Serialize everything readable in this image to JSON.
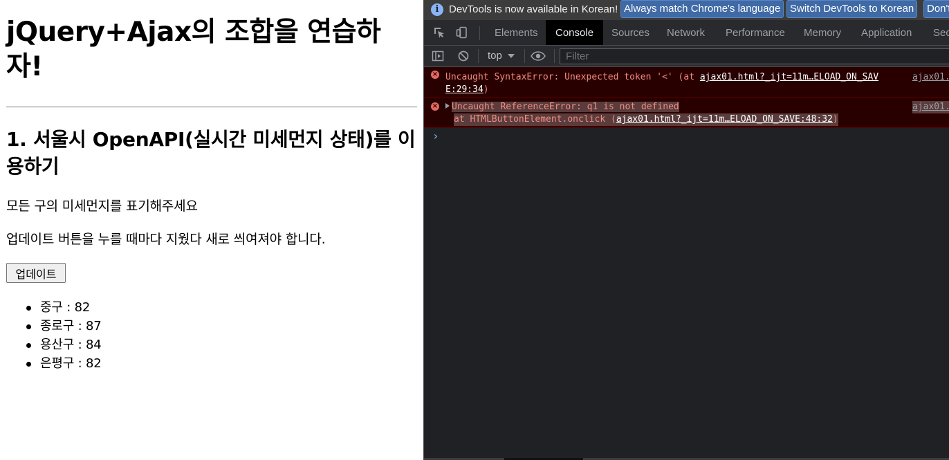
{
  "page": {
    "title": "jQuery+Ajax의 조합을 연습하자!",
    "section_title": "1. 서울시 OpenAPI(실시간 미세먼지 상태)를 이용하기",
    "instruction1": "모든 구의 미세먼지를 표기해주세요",
    "instruction2": "업데이트 버튼을 누를 때마다 지웠다 새로 씌여져야 합니다.",
    "update_button": "업데이트",
    "districts": [
      "중구 : 82",
      "종로구 : 87",
      "용산구 : 84",
      "은평구 : 82"
    ]
  },
  "devtools": {
    "infobar": {
      "text": "DevTools is now available in Korean!",
      "button_match": "Always match Chrome's language",
      "button_switch": "Switch DevTools to Korean",
      "button_dont": "Don't"
    },
    "tabs": [
      "Elements",
      "Console",
      "Sources",
      "Network",
      "Performance",
      "Memory",
      "Application",
      "Sec"
    ],
    "active_tab": "Console",
    "context": "top",
    "filter_placeholder": "Filter",
    "messages": [
      {
        "text_prefix": "Uncaught SyntaxError: Unexpected token '<' (at ",
        "link_part1": "ajax01.html?_ijt=11m…ELOAD_ON_SAV",
        "link_part2": "E:29:34",
        "text_suffix": ")",
        "source": "ajax01."
      },
      {
        "text": "Uncaught ReferenceError: q1 is not defined",
        "stack_prefix": "    at HTMLButtonElement.onclick (",
        "stack_link": "ajax01.html?_ijt=11m…ELOAD_ON_SAVE:48:32",
        "stack_suffix": ")",
        "source": "ajax01."
      }
    ],
    "prompt": "›"
  }
}
